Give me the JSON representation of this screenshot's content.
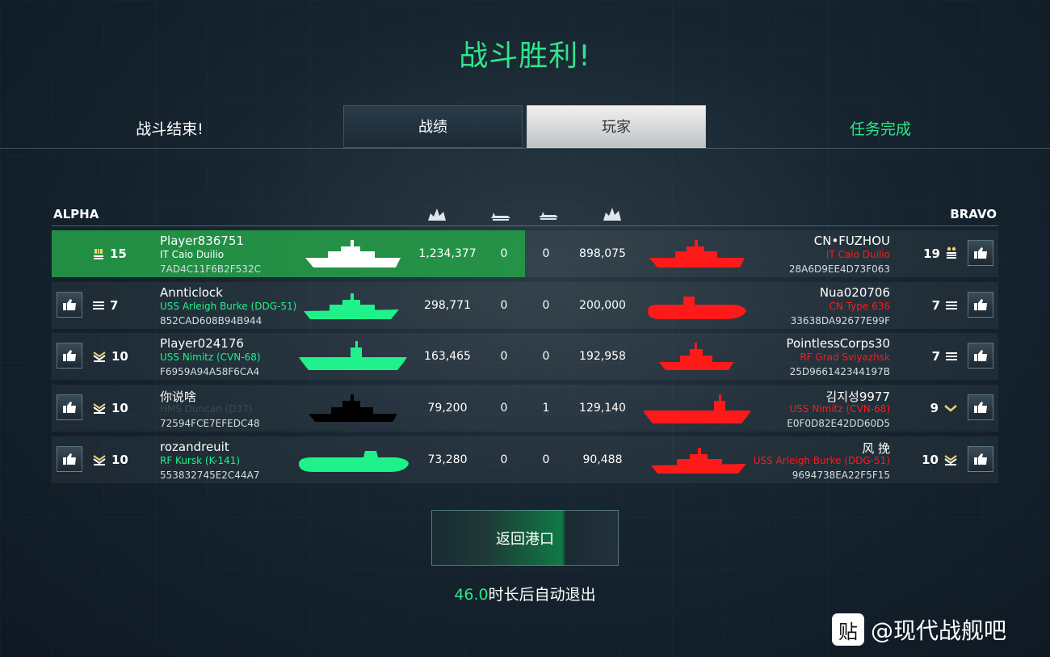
{
  "header": {
    "title": "战斗胜利!",
    "status_left": "战斗结束!",
    "status_right": "任务完成",
    "tab_stats": "战绩",
    "tab_players": "玩家"
  },
  "teams": {
    "alpha": "ALPHA",
    "bravo": "BRAVO"
  },
  "column_icons": [
    "damage-dealt-icon",
    "torpedo-icon",
    "ship-kill-icon",
    "damage-received-icon"
  ],
  "colors": {
    "accent_green": "#2ee58a",
    "ally_ship": "#1ff28a",
    "enemy": "#ff1a1a",
    "highlight_row": "#22a046"
  },
  "rows": [
    {
      "left": {
        "name": "Player836751",
        "ship": "IT Caio Duilio",
        "id": "7AD4C11F6B2F532C",
        "rank": "15",
        "rank_icon": "stack-chevron-icon"
      },
      "stats": [
        "1,234,377",
        "0",
        "0",
        "898,075"
      ],
      "right": {
        "name": "CN•FUZHOU",
        "ship": "IT Caio Duilio",
        "id": "28A6D9EE4D73F063",
        "rank": "19",
        "rank_icon": "star-bar-icon"
      }
    },
    {
      "left": {
        "name": "Annticlock",
        "ship": "USS Arleigh Burke (DDG-51)",
        "id": "852CAD608B94B944",
        "rank": "7",
        "rank_icon": "bars-icon"
      },
      "stats": [
        "298,771",
        "0",
        "0",
        "200,000"
      ],
      "right": {
        "name": "Nua020706",
        "ship": "CN Type 636",
        "id": "33638DA92677E99F",
        "rank": "7",
        "rank_icon": "bars-icon"
      }
    },
    {
      "left": {
        "name": "Player024176",
        "ship": "USS Nimitz (CVN-68)",
        "id": "F6959A94A58F6CA4",
        "rank": "10",
        "rank_icon": "chevron-stack-icon"
      },
      "stats": [
        "163,465",
        "0",
        "0",
        "192,958"
      ],
      "right": {
        "name": "PointlessCorps30",
        "ship": "RF Grad Sviyazhsk",
        "id": "25D966142344197B",
        "rank": "7",
        "rank_icon": "bars-icon"
      }
    },
    {
      "left": {
        "name": "你说啥",
        "ship": "HMS Duncan (D37)",
        "id": "72594FCE7EFEDC48",
        "rank": "10",
        "rank_icon": "chevron-stack-icon"
      },
      "stats": [
        "79,200",
        "0",
        "1",
        "129,140"
      ],
      "right": {
        "name": "김지성9977",
        "ship": "USS Nimitz (CVN-68)",
        "id": "E0F0D82E42DD60D5",
        "rank": "9",
        "rank_icon": "chevron-icon"
      }
    },
    {
      "left": {
        "name": "rozandreuit",
        "ship": "RF Kursk (K-141)",
        "id": "553832745E2C44A7",
        "rank": "10",
        "rank_icon": "chevron-stack-icon"
      },
      "stats": [
        "73,280",
        "0",
        "0",
        "90,488"
      ],
      "right": {
        "name": "风 挽",
        "ship": "USS Arleigh Burke (DDG-51)",
        "id": "9694738EA22F5F15",
        "rank": "10",
        "rank_icon": "chevron-stack-icon"
      }
    }
  ],
  "return_button": "返回港口",
  "countdown": {
    "seconds": "46.0",
    "suffix": "时长后自动退出"
  },
  "watermark": {
    "icon": "贴",
    "text": "@现代战舰吧"
  }
}
